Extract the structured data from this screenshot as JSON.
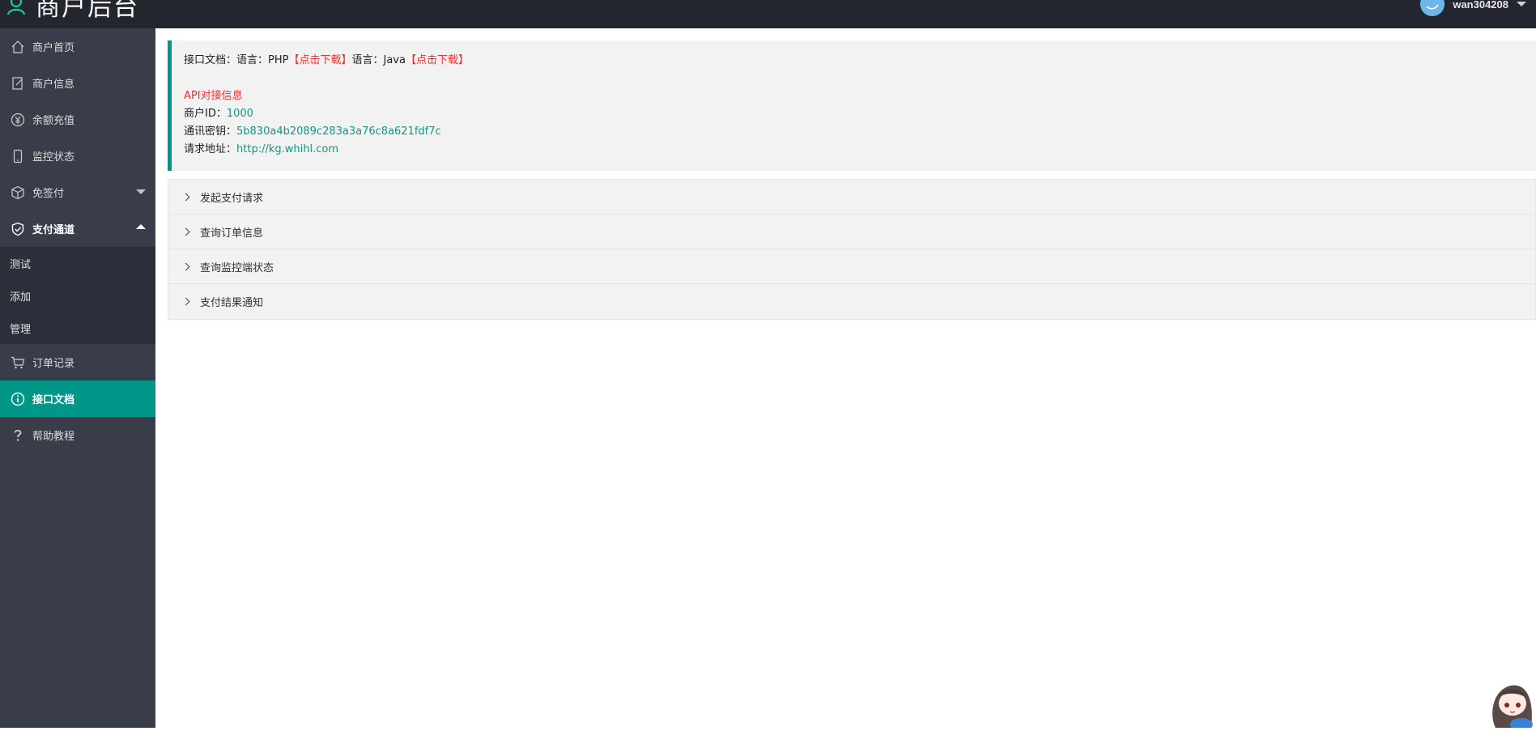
{
  "header": {
    "title": "商户后台",
    "username": "wan304208"
  },
  "sidebar": {
    "items": [
      {
        "label": "商户首页",
        "icon": "home-icon"
      },
      {
        "label": "商户信息",
        "icon": "edit-doc-icon"
      },
      {
        "label": "余额充值",
        "icon": "yen-icon"
      },
      {
        "label": "监控状态",
        "icon": "phone-icon"
      },
      {
        "label": "免签付",
        "icon": "cube-icon"
      },
      {
        "label": "支付通道",
        "icon": "shield-check-icon"
      },
      {
        "label": "订单记录",
        "icon": "cart-icon"
      },
      {
        "label": "接口文档",
        "icon": "info-icon"
      },
      {
        "label": "帮助教程",
        "icon": "help-icon"
      }
    ],
    "subitems": [
      "测试",
      "添加",
      "管理"
    ]
  },
  "docs": {
    "doc_label": "接口文档：",
    "lang_label_1": "语言：PHP",
    "download_1": "【点击下载】",
    "lang_label_2": "语言：Java",
    "download_2": "【点击下载】",
    "api_heading": "API对接信息",
    "merchant_id_label": "商户ID：",
    "merchant_id": "1000",
    "secret_label": "通讯密钥：",
    "secret": "5b830a4b2089c283a3a76c8a621fdf7c",
    "url_label": "请求地址：",
    "url": "http://kg.whihl.com"
  },
  "collapse": [
    "发起支付请求",
    "查询订单信息",
    "查询监控端状态",
    "支付结果通知"
  ],
  "colors": {
    "header_bg": "#23262e",
    "sidebar_bg": "#393d49",
    "active_bg": "#009688",
    "link_red": "#ff2a2a",
    "value_green": "#14967f"
  }
}
